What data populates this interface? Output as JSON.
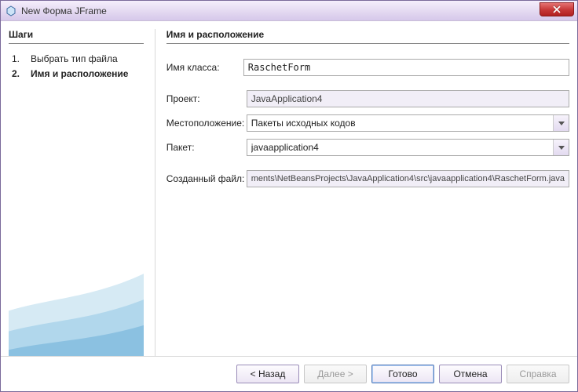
{
  "window": {
    "title": "New Форма JFrame"
  },
  "sidebar": {
    "heading": "Шаги",
    "steps": [
      {
        "num": "1.",
        "label": "Выбрать тип файла",
        "active": false
      },
      {
        "num": "2.",
        "label": "Имя и расположение",
        "active": true
      }
    ]
  },
  "main": {
    "heading": "Имя и расположение",
    "fields": {
      "classname_label": "Имя класса:",
      "classname_value": "RaschetForm",
      "project_label": "Проект:",
      "project_value": "JavaApplication4",
      "location_label": "Местоположение:",
      "location_value": "Пакеты исходных кодов",
      "package_label": "Пакет:",
      "package_value": "javaapplication4",
      "createdfile_label": "Созданный файл:",
      "createdfile_value": "ments\\NetBeansProjects\\JavaApplication4\\src\\javaapplication4\\RaschetForm.java"
    }
  },
  "buttons": {
    "back": "< Назад",
    "next": "Далее >",
    "finish": "Готово",
    "cancel": "Отмена",
    "help": "Справка"
  }
}
